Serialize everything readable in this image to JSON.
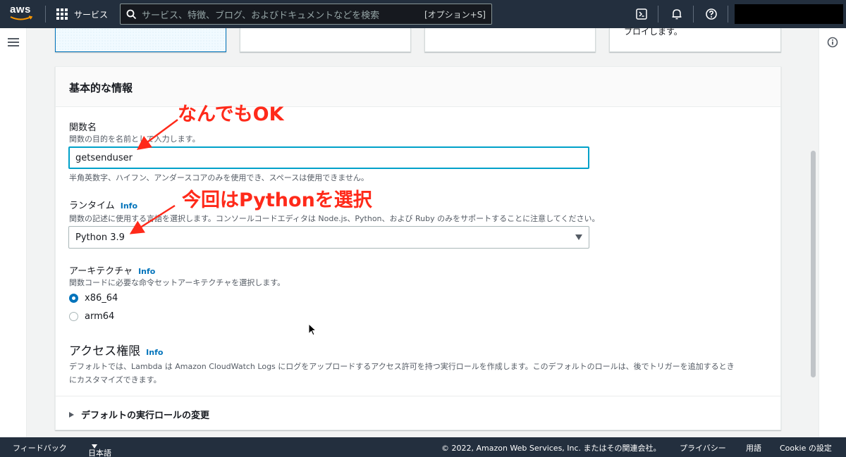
{
  "nav": {
    "logo_text": "aws",
    "services_label": "サービス",
    "search_placeholder": "サービス、特徴、ブログ、およびドキュメントなどを検索",
    "search_shortcut": "[オプション+S]",
    "icons": [
      "cloudshell-icon",
      "bell-icon",
      "help-icon"
    ]
  },
  "cards": {
    "card4_text": "プロイします。"
  },
  "panel": {
    "title": "基本的な情報",
    "function_name": {
      "label": "関数名",
      "description": "関数の目的を名前として入力します。",
      "value": "getsenduser",
      "hint": "半角英数字、ハイフン、アンダースコアのみを使用でき、スペースは使用できません。"
    },
    "runtime": {
      "label": "ランタイム",
      "info": "Info",
      "description": "関数の記述に使用する言語を選択します。コンソールコードエディタは Node.js、Python、および Ruby のみをサポートすることに注意してください。",
      "selected": "Python 3.9"
    },
    "architecture": {
      "label": "アーキテクチャ",
      "info": "Info",
      "description": "関数コードに必要な命令セットアーキテクチャを選択します。",
      "options": [
        {
          "label": "x86_64",
          "checked": true
        },
        {
          "label": "arm64",
          "checked": false
        }
      ]
    },
    "access": {
      "title": "アクセス権限",
      "info": "Info",
      "description_line1": "デフォルトでは、Lambda は Amazon CloudWatch Logs にログをアップロードするアクセス許可を持つ実行ロールを作成します。このデフォルトのロールは、後でトリガーを追加するとき",
      "description_line2": "にカスタマイズできます。",
      "expander_label": "デフォルトの実行ロールの変更"
    }
  },
  "annotations": {
    "note1": "なんでもOK",
    "note2": "今回はPythonを選択",
    "color": "#ff2a1a"
  },
  "footer": {
    "feedback": "フィードバック",
    "language": "日本語",
    "copyright": "© 2022, Amazon Web Services, Inc. またはその関連会社。",
    "privacy": "プライバシー",
    "terms": "用語",
    "cookie": "Cookie の設定"
  },
  "colors": {
    "nav_bg": "#232f3e",
    "link": "#0073bb",
    "focus": "#00a1c9"
  }
}
